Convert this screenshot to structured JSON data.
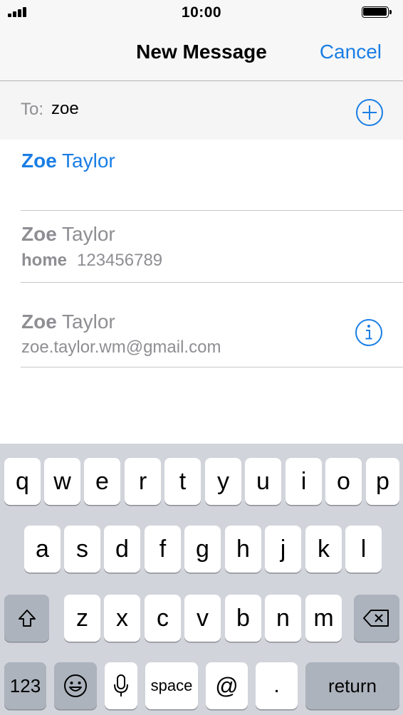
{
  "status_bar": {
    "time": "10:00"
  },
  "nav": {
    "title": "New Message",
    "cancel_label": "Cancel"
  },
  "to_field": {
    "label": "To:",
    "value": "zoe"
  },
  "suggestions": [
    {
      "name_bold": "Zoe",
      "name_rest": " Taylor"
    },
    {
      "name_bold": "Zoe",
      "name_rest": " Taylor",
      "detail_label": "home",
      "detail_value": "123456789"
    },
    {
      "name_bold": "Zoe",
      "name_rest": " Taylor",
      "detail_value": "zoe.taylor.wm@gmail.com"
    }
  ],
  "keyboard": {
    "row1": [
      "q",
      "w",
      "e",
      "r",
      "t",
      "y",
      "u",
      "i",
      "o",
      "p"
    ],
    "row2": [
      "a",
      "s",
      "d",
      "f",
      "g",
      "h",
      "j",
      "k",
      "l"
    ],
    "row3": [
      "z",
      "x",
      "c",
      "v",
      "b",
      "n",
      "m"
    ],
    "numbers_label": "123",
    "space_label": "space",
    "at_label": "@",
    "dot_label": ".",
    "return_label": "return"
  },
  "icons": {
    "signal": "cellular-signal-icon",
    "battery": "battery-icon",
    "add": "plus-circle-icon",
    "info": "info-circle-icon",
    "shift": "shift-arrow-icon",
    "delete": "backspace-icon",
    "emoji": "smiley-face-icon",
    "mic": "microphone-icon"
  },
  "colors": {
    "accent": "#1a7ee5",
    "secondary_text": "#8e8e93",
    "keyboard_bg": "#d1d4da",
    "function_key": "#acb3bd"
  }
}
